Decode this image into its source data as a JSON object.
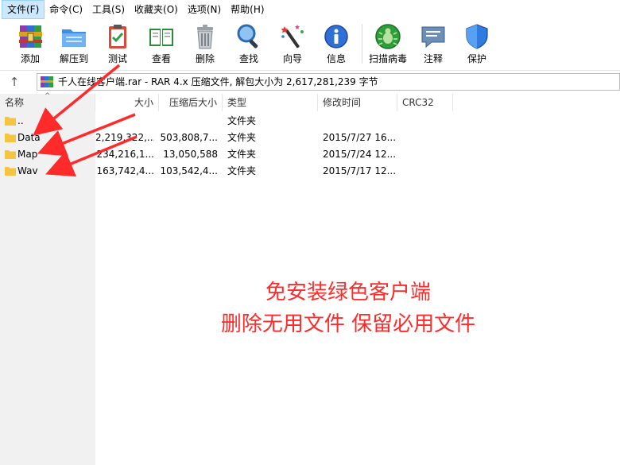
{
  "menu": {
    "items": [
      "文件(F)",
      "命令(C)",
      "工具(S)",
      "收藏夹(O)",
      "选项(N)",
      "帮助(H)"
    ]
  },
  "toolbar": {
    "buttons": [
      {
        "label": "添加",
        "icon": "add-archive-icon"
      },
      {
        "label": "解压到",
        "icon": "extract-folder-icon"
      },
      {
        "label": "测试",
        "icon": "test-clipboard-icon"
      },
      {
        "label": "查看",
        "icon": "view-book-icon"
      },
      {
        "label": "删除",
        "icon": "trash-icon"
      },
      {
        "label": "查找",
        "icon": "magnifier-icon"
      },
      {
        "label": "向导",
        "icon": "wizard-wand-icon"
      },
      {
        "label": "信息",
        "icon": "info-icon"
      },
      {
        "label": "扫描病毒",
        "icon": "virus-scan-icon"
      },
      {
        "label": "注释",
        "icon": "comment-icon"
      },
      {
        "label": "保护",
        "icon": "shield-icon"
      }
    ]
  },
  "address": {
    "up_symbol": "↑",
    "path": "千人在线客户端.rar - RAR 4.x 压缩文件, 解包大小为 2,617,281,239 字节"
  },
  "columns": {
    "name": "名称",
    "size": "大小",
    "packed": "压缩后大小",
    "type": "类型",
    "modified": "修改时间",
    "crc": "CRC32"
  },
  "rows": [
    {
      "name": "..",
      "size": "",
      "packed": "",
      "type": "文件夹",
      "modified": ""
    },
    {
      "name": "Data",
      "size": "2,219,322,...",
      "packed": "503,808,7...",
      "type": "文件夹",
      "modified": "2015/7/27 16..."
    },
    {
      "name": "Map",
      "size": "234,216,1...",
      "packed": "13,050,588",
      "type": "文件夹",
      "modified": "2015/7/24 12..."
    },
    {
      "name": "Wav",
      "size": "163,742,4...",
      "packed": "103,542,4...",
      "type": "文件夹",
      "modified": "2015/7/17 12..."
    }
  ],
  "annotation": {
    "line1": "免安装绿色客户端",
    "line2": "删除无用文件 保留必用文件",
    "color": "#ff2a2a"
  },
  "colors": {
    "menu_active_bg": "#cce8ff",
    "folder": "#f5c542",
    "left_pane": "#f1f1f1"
  }
}
